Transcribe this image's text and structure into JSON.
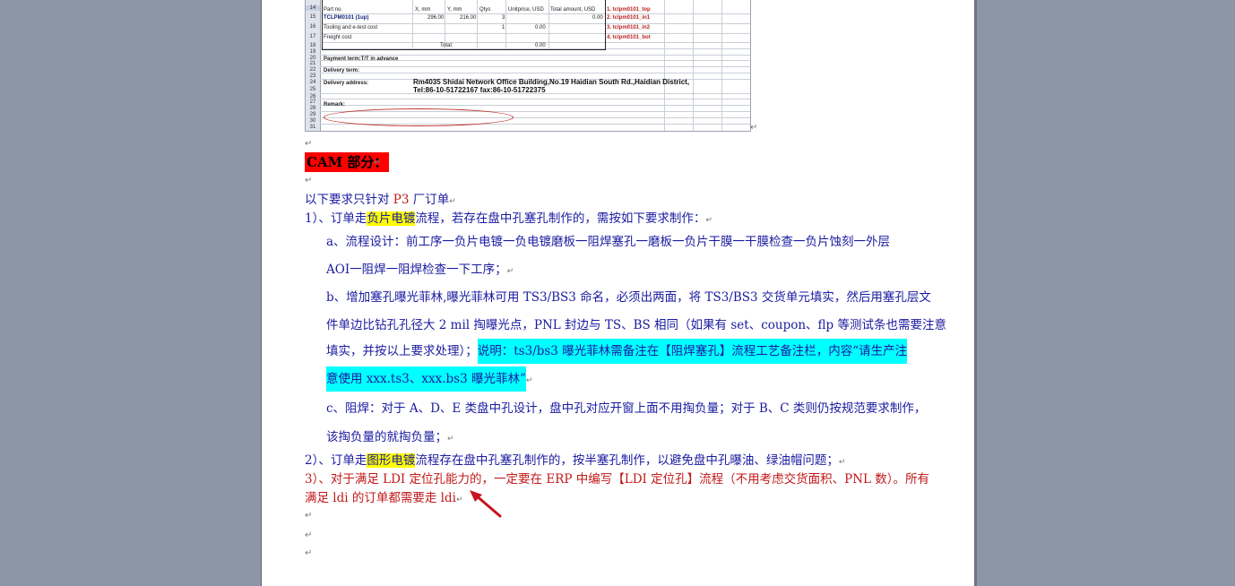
{
  "sheet": {
    "rows": [
      "14",
      "15",
      "16",
      "17",
      "18",
      "19",
      "20",
      "21",
      "22",
      "23",
      "24",
      "25",
      "26",
      "27",
      "28",
      "29",
      "30",
      "31"
    ],
    "headers": [
      "Part no.",
      "X, mm",
      "Y, mm",
      "Qtys",
      "Unitprice, USD",
      "Total amount, USD"
    ],
    "part_no": "TCLPM0101 (1up)",
    "x_mm": "296.00",
    "y_mm": "216.00",
    "qty": "3",
    "total_amount": "0.00",
    "tooling": "Tooling and e-test cost",
    "tooling_qty": "1",
    "tooling_price": "0.00",
    "freight": "Freight cost",
    "total_label": "Total:",
    "total_value": "0.00",
    "files": [
      "1. tclpm0101_top",
      "2. tclpm0101_in1",
      "3. tclpm0101_in2",
      "4. tclpm0101_bot"
    ],
    "payment_term": "Payment term:T/T in advance",
    "delivery_term": "Delivery term:",
    "delivery_address_label": "Delivery address:",
    "address_line1": "Rm4035 Shidai Network Office Building,No.19 Haidian South Rd.,Haidian District,",
    "address_line2": "Tel:86-10-51722167 fax:86-10-51722375",
    "remark": "Remark:"
  },
  "doc": {
    "cam_label": "CAM 部分：",
    "intro_a": "以下要求只针对 ",
    "intro_p3": "P3",
    "intro_b": " 厂订单",
    "item1_a": "1）、订单走",
    "item1_hl": "负片电镀",
    "item1_b": "流程，若存在盘中孔塞孔制作的，需按如下要求制作：",
    "a1": "a、流程设计：前工序一负片电镀一负电镀磨板一阻焊塞孔一磨板一负片干膜一干膜检查一负片蚀刻一外层",
    "a2": "AOI一阻焊一阻焊检查一下工序；",
    "b1": "b、增加塞孔曝光菲林,曝光菲林可用 TS3/BS3 命名，必须出两面，将 TS3/BS3 交货单元填实，然后用塞孔层文",
    "b2": "件单边比钻孔孔径大 2 mil 掏曝光点，PNL 封边与 TS、BS 相同（如果有 set、coupon、flp 等测试条也需要注意",
    "b3_plain": "填实，并按以上要求处理）；",
    "b3_hl": "说明：ts3/bs3 曝光菲林需备注在【阻焊塞孔】流程工艺备注栏，内容“请生产注",
    "b4_hl": "意使用 xxx.ts3、xxx.bs3 曝光菲林”",
    "c1": "c、阻焊：对于 A、D、E 类盘中孔设计，盘中孔对应开窗上面不用掏负量；对于 B、C 类则仍按规范要求制作，",
    "c2": "该掏负量的就掏负量；",
    "item2_a": "2）、订单走",
    "item2_hl": "图形电镀",
    "item2_b": "流程存在盘中孔塞孔制作的，按半塞孔制作，以避免盘中孔曝油、绿油帽问题；",
    "item3_1": "3）、对于满足 LDI 定位孔能力的，一定要在 ERP 中编写【LDI 定位孔】流程（不用考虑交货面积、PNL 数）。所有",
    "item3_2": "满足 ldi 的订单都需要走 ldi",
    "para_mark": "↵"
  },
  "colors": {
    "highlight_yellow": "#ffff00",
    "highlight_cyan": "#00ffff",
    "cam_red": "#ff0000",
    "text_blue": "#1a1aa0",
    "text_red": "#c21818"
  }
}
